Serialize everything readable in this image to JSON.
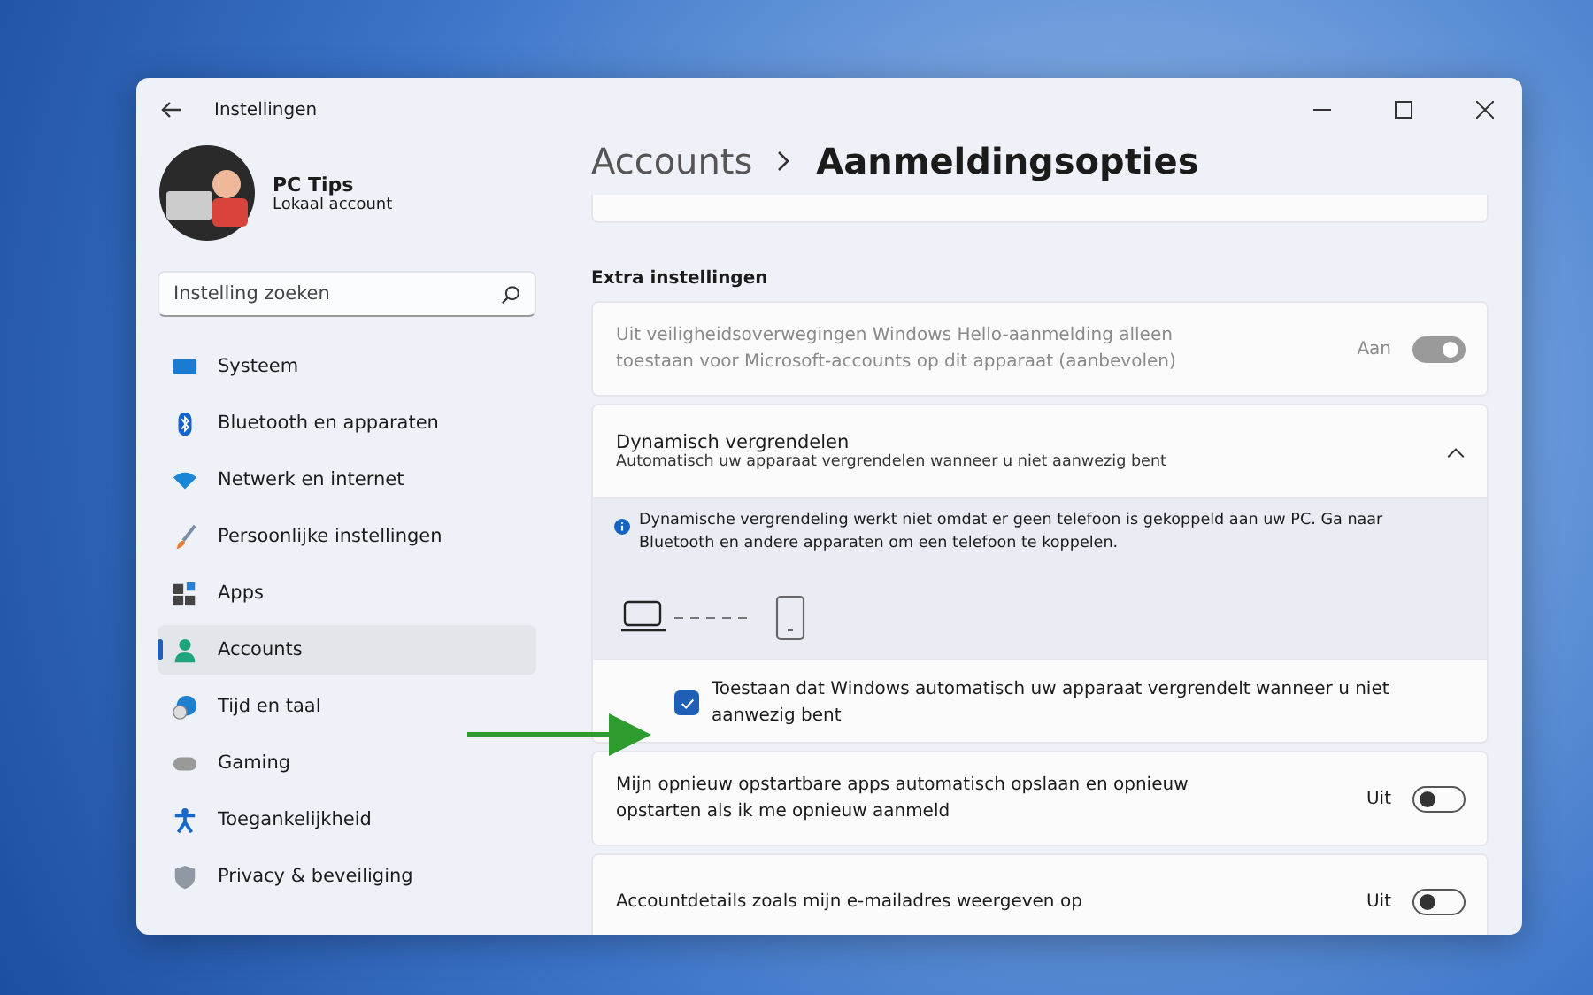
{
  "window": {
    "title": "Instellingen"
  },
  "user": {
    "name": "PC Tips",
    "account_type": "Lokaal account"
  },
  "search": {
    "placeholder": "Instelling zoeken"
  },
  "sidebar": {
    "items": [
      {
        "label": "Systeem",
        "selected": false
      },
      {
        "label": "Bluetooth en apparaten",
        "selected": false
      },
      {
        "label": "Netwerk en internet",
        "selected": false
      },
      {
        "label": "Persoonlijke instellingen",
        "selected": false
      },
      {
        "label": "Apps",
        "selected": false
      },
      {
        "label": "Accounts",
        "selected": true
      },
      {
        "label": "Tijd en taal",
        "selected": false
      },
      {
        "label": "Gaming",
        "selected": false
      },
      {
        "label": "Toegankelijkheid",
        "selected": false
      },
      {
        "label": "Privacy & beveiliging",
        "selected": false
      }
    ]
  },
  "breadcrumb": {
    "parent": "Accounts",
    "current": "Aanmeldingsopties"
  },
  "section_title": "Extra instellingen",
  "settings": [
    {
      "kind": "toggle",
      "label": "Uit veiligheidsoverwegingen Windows Hello-aanmelding alleen toestaan voor Microsoft-accounts op dit apparaat (aanbevolen)",
      "state_label": "Aan",
      "on": true,
      "disabled": true
    },
    {
      "kind": "expander",
      "title": "Dynamisch vergrendelen",
      "description": "Automatisch uw apparaat vergrendelen wanneer u niet aanwezig bent",
      "expanded": true,
      "info": "Dynamische vergrendeling werkt niet omdat er geen telefoon is gekoppeld aan uw PC. Ga naar Bluetooth en andere apparaten om een telefoon te koppelen.",
      "checkbox": {
        "label": "Toestaan dat Windows automatisch uw apparaat vergrendelt wanneer u niet aanwezig bent",
        "checked": true
      }
    },
    {
      "kind": "toggle",
      "label": "Mijn opnieuw opstartbare apps automatisch opslaan en opnieuw opstarten als ik me opnieuw aanmeld",
      "state_label": "Uit",
      "on": false,
      "disabled": false
    },
    {
      "kind": "toggle",
      "label": "Accountdetails zoals mijn e-mailadres weergeven op",
      "state_label": "Uit",
      "on": false,
      "disabled": false
    }
  ]
}
